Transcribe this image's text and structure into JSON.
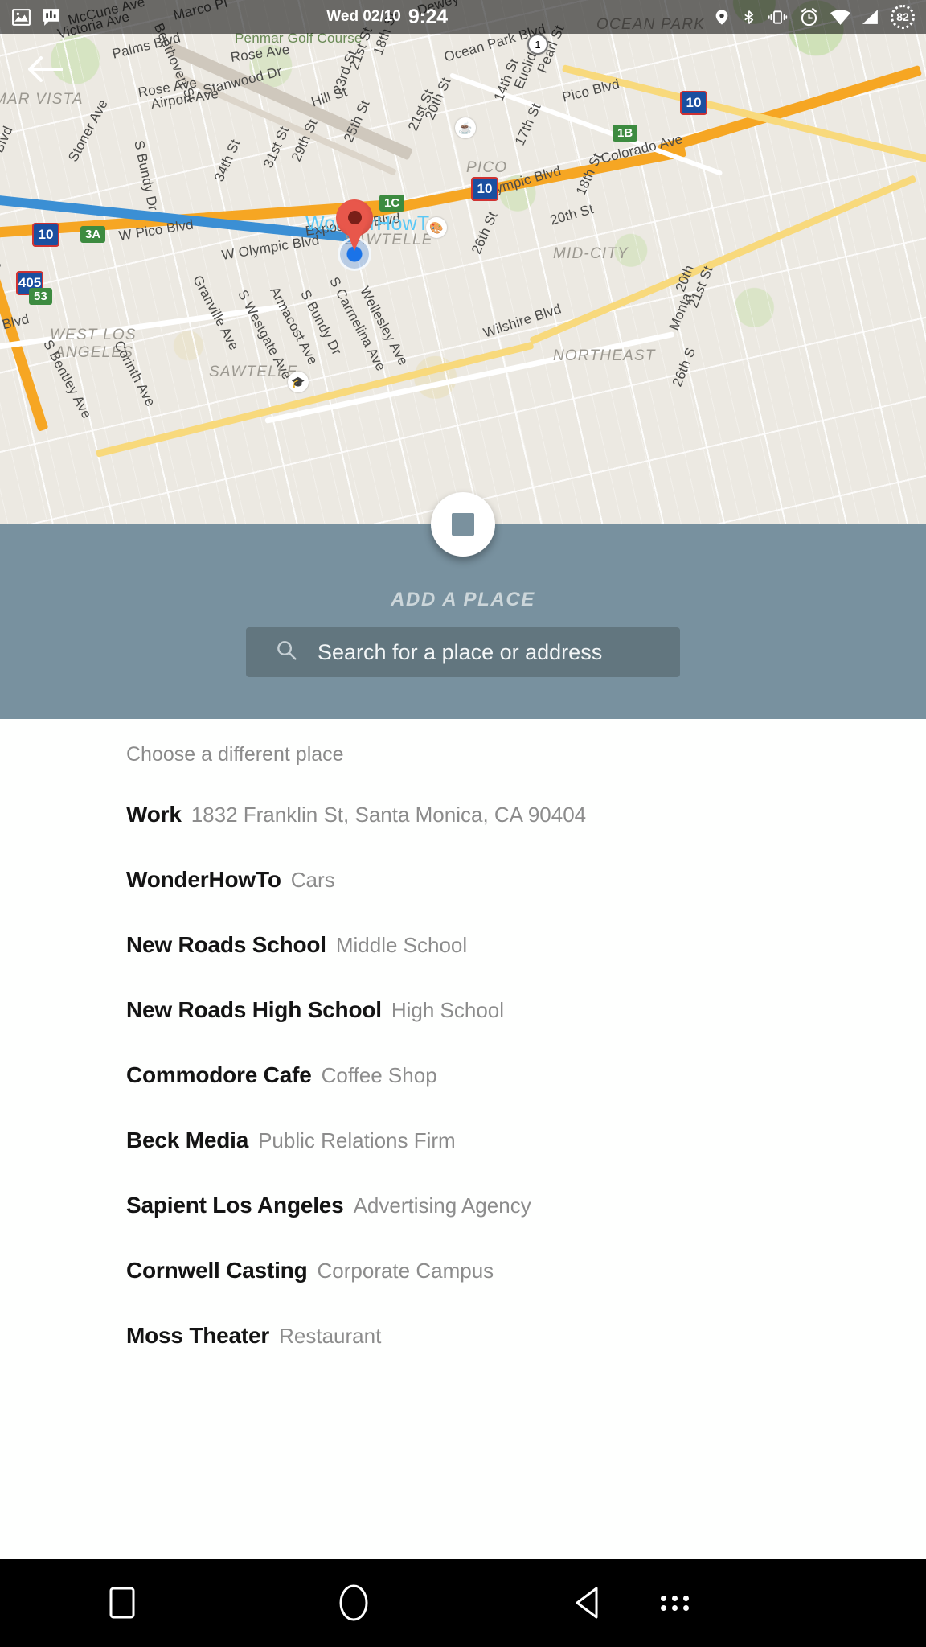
{
  "statusbar": {
    "date": "Wed 02/10",
    "time": "9:24",
    "left_icons": [
      "image-icon",
      "opinion-rewards-icon"
    ],
    "right_icons": [
      "location-icon",
      "bluetooth-icon",
      "vibrate-icon",
      "alarm-icon",
      "wifi-icon",
      "signal-icon"
    ],
    "battery_level": "82"
  },
  "map": {
    "back_button": "back-arrow",
    "marker_label": "WonderHowTo",
    "labels": [
      {
        "text": "McCune Ave"
      },
      {
        "text": "Victoria Ave"
      },
      {
        "text": "Marco Pl"
      },
      {
        "text": "Beethoven St"
      },
      {
        "text": "Penmar Golf Course"
      },
      {
        "text": "Dewey St"
      },
      {
        "text": "OCEAN PARK"
      },
      {
        "text": "Palms Blvd"
      },
      {
        "text": "Rose Ave"
      },
      {
        "text": "Rose Ave"
      },
      {
        "text": "Stanwood Dr"
      },
      {
        "text": "Airport Ave"
      },
      {
        "text": "MAR VISTA"
      },
      {
        "text": "S Bundy Dr"
      },
      {
        "text": "Stoner Ave"
      },
      {
        "text": "Hill St"
      },
      {
        "text": "23rd St"
      },
      {
        "text": "21st St"
      },
      {
        "text": "18th St"
      },
      {
        "text": "Ocean Park Blvd"
      },
      {
        "text": "Pearl St"
      },
      {
        "text": "Euclid St"
      },
      {
        "text": "14th St"
      },
      {
        "text": "Pico Blvd"
      },
      {
        "text": "Colorado Ave"
      },
      {
        "text": "17th St"
      },
      {
        "text": "PICO"
      },
      {
        "text": "25th St"
      },
      {
        "text": "20th St"
      },
      {
        "text": "21st St"
      },
      {
        "text": "29th St"
      },
      {
        "text": "31st St"
      },
      {
        "text": "34th St"
      },
      {
        "text": "Olympic Blvd"
      },
      {
        "text": "20th St"
      },
      {
        "text": "18th St"
      },
      {
        "text": "W Pico Blvd"
      },
      {
        "text": "W Olympic Blvd"
      },
      {
        "text": "Exposition Blvd"
      },
      {
        "text": "SAWTELLE"
      },
      {
        "text": "26th St"
      },
      {
        "text": "MID-CITY"
      },
      {
        "text": "Granville Ave"
      },
      {
        "text": "S Westgate Ave"
      },
      {
        "text": "Armacost Ave"
      },
      {
        "text": "S Bundy Dr"
      },
      {
        "text": "S Carmelina Ave"
      },
      {
        "text": "Wellesley Ave"
      },
      {
        "text": "Wilshire Blvd"
      },
      {
        "text": "NORTHEAST"
      },
      {
        "text": "WEST LOS ANGELES"
      },
      {
        "text": "Corinth Ave"
      },
      {
        "text": "S Bentley Ave"
      },
      {
        "text": "Pacific Blvd"
      },
      {
        "text": "SAWTELLE"
      },
      {
        "text": "Montana Ave"
      },
      {
        "text": "20th St"
      },
      {
        "text": "21st St"
      },
      {
        "text": "26th St"
      }
    ],
    "shields": [
      "10",
      "10",
      "405",
      "10"
    ],
    "exits": [
      "3A",
      "1B",
      "1C",
      "53",
      "1"
    ]
  },
  "add_panel": {
    "fab_icon": "stop-square-icon",
    "title": "ADD A PLACE",
    "search_placeholder": "Search for a place or address",
    "search_icon": "search-icon",
    "bg_color": "#78919f",
    "search_bg_color": "#62767f"
  },
  "list": {
    "header": "Choose a different place",
    "places": [
      {
        "name": "Work",
        "sub": "1832 Franklin St, Santa Monica, CA 90404"
      },
      {
        "name": "WonderHowTo",
        "sub": "Cars"
      },
      {
        "name": "New Roads School",
        "sub": "Middle School"
      },
      {
        "name": "New Roads High School",
        "sub": "High School"
      },
      {
        "name": "Commodore Cafe",
        "sub": "Coffee Shop"
      },
      {
        "name": "Beck Media",
        "sub": "Public Relations Firm"
      },
      {
        "name": "Sapient Los Angeles",
        "sub": "Advertising Agency"
      },
      {
        "name": "Cornwell Casting",
        "sub": "Corporate Campus"
      },
      {
        "name": "Moss Theater",
        "sub": "Restaurant"
      }
    ]
  },
  "navbar": {
    "recents_icon": "recents-square-icon",
    "home_icon": "home-circle-icon",
    "back_icon": "back-triangle-icon",
    "menu_icon": "more-dots-icon"
  }
}
